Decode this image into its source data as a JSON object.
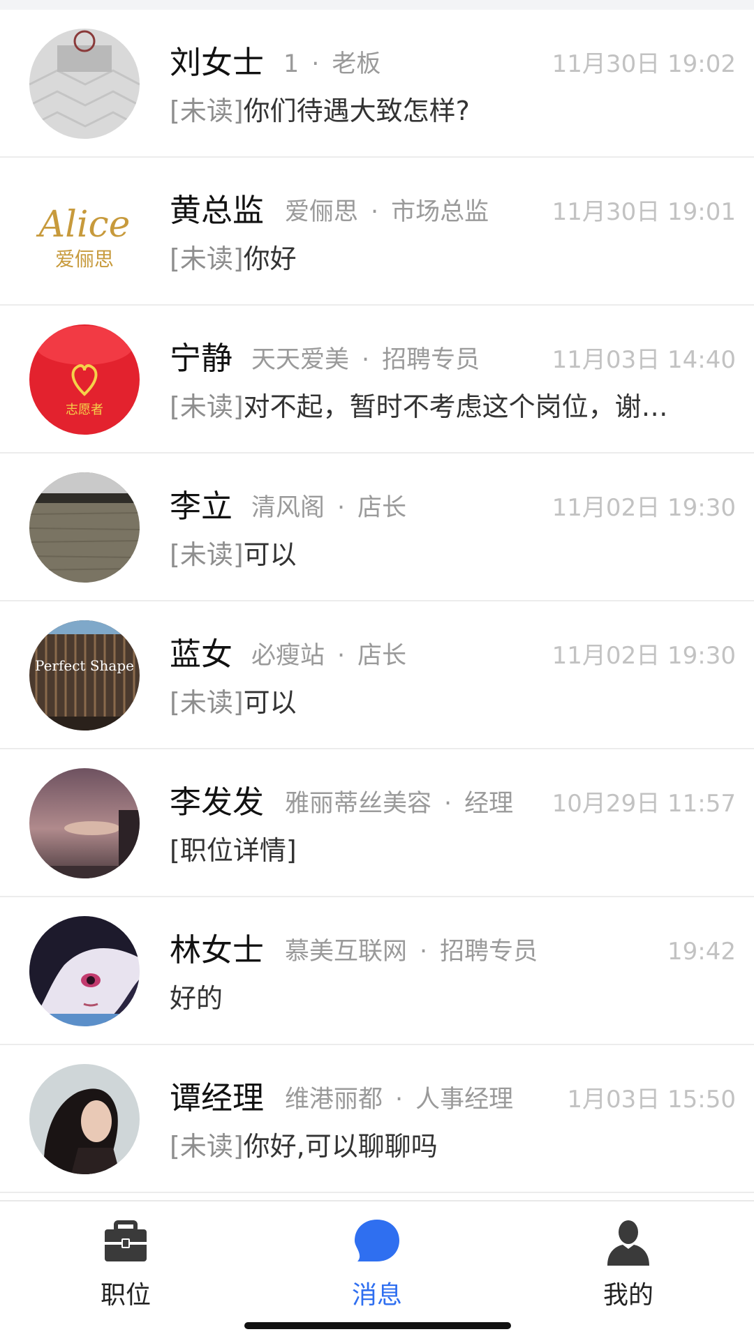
{
  "conversations": [
    {
      "name": "刘女士",
      "company": "1",
      "role": "老板",
      "time": "11月30日 19:02",
      "unread_tag": "[未读]",
      "message": "你们待遇大致怎样?"
    },
    {
      "name": "黄总监",
      "company": "爱俪思",
      "role": "市场总监",
      "time": "11月30日 19:01",
      "unread_tag": "[未读]",
      "message": "你好",
      "avatar_text": "Alice",
      "avatar_subtext": "爱俪思"
    },
    {
      "name": "宁静",
      "company": "天天爱美",
      "role": "招聘专员",
      "time": "11月03日 14:40",
      "unread_tag": "[未读]",
      "message": "对不起，暂时不考虑这个岗位，谢…",
      "avatar_text": "志愿者"
    },
    {
      "name": "李立",
      "company": "清风阁",
      "role": "店长",
      "time": "11月02日 19:30",
      "unread_tag": "[未读]",
      "message": "可以"
    },
    {
      "name": "蓝女",
      "company": "必瘦站",
      "role": "店长",
      "time": "11月02日 19:30",
      "unread_tag": "[未读]",
      "message": "可以",
      "avatar_text": "Perfect Shape"
    },
    {
      "name": "李发发",
      "company": "雅丽蒂丝美容",
      "role": "经理",
      "time": "10月29日 11:57",
      "unread_tag": "",
      "message": "[职位详情]"
    },
    {
      "name": "林女士",
      "company": "慕美互联网",
      "role": "招聘专员",
      "time": "19:42",
      "unread_tag": "",
      "message": "好的"
    },
    {
      "name": "谭经理",
      "company": "维港丽都",
      "role": "人事经理",
      "time": "1月03日 15:50",
      "unread_tag": "[未读]",
      "message": "你好,可以聊聊吗"
    }
  ],
  "separator": "·",
  "tabbar": {
    "tabs": [
      {
        "label": "职位",
        "icon": "briefcase-icon"
      },
      {
        "label": "消息",
        "icon": "chat-bubble-icon"
      },
      {
        "label": "我的",
        "icon": "person-icon"
      }
    ],
    "active_color": "#2f6ff0"
  }
}
